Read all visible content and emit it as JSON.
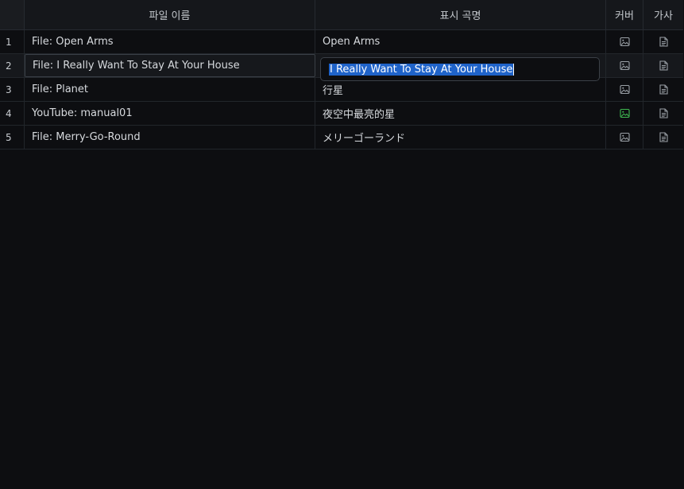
{
  "headers": {
    "file_name": "파일 이름",
    "display_title": "표시 곡명",
    "cover": "커버",
    "lyrics": "가사"
  },
  "rows": [
    {
      "index": "1",
      "file": "File: Open Arms",
      "title": "Open Arms",
      "cover_icon": "image-icon",
      "cover_set": false,
      "lyrics_icon": "document-icon"
    },
    {
      "index": "2",
      "file": "File: I Really Want To Stay At Your House",
      "title": "I Really Want To Stay At Your House",
      "cover_icon": "image-icon",
      "cover_set": false,
      "lyrics_icon": "document-icon"
    },
    {
      "index": "3",
      "file": "File: Planet",
      "title": "行星",
      "cover_icon": "image-icon",
      "cover_set": false,
      "lyrics_icon": "document-icon"
    },
    {
      "index": "4",
      "file": "YouTube: manual01",
      "title": "夜空中最亮的星",
      "cover_icon": "image-icon",
      "cover_set": true,
      "lyrics_icon": "document-icon"
    },
    {
      "index": "5",
      "file": "File: Merry-Go-Round",
      "title": "メリーゴーランド",
      "cover_icon": "image-icon",
      "cover_set": false,
      "lyrics_icon": "document-icon"
    }
  ],
  "editor": {
    "value": "I Really Want To Stay At Your House"
  },
  "colors": {
    "background": "#0d0e11",
    "header": "#15171b",
    "selection": "#1f63c9",
    "cover_set": "#3fb950",
    "icon": "#9aa0a6"
  }
}
